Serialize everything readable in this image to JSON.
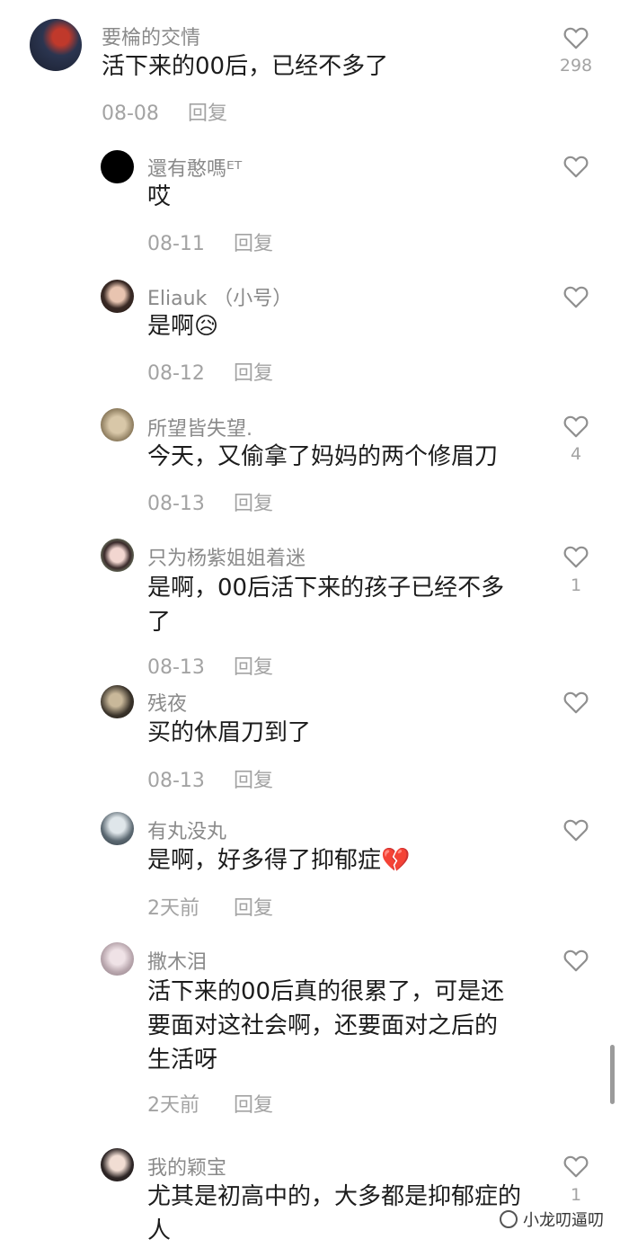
{
  "comments": [
    {
      "username": "要棆的交情",
      "text": "活下来的00后，已经不多了",
      "date": "08-08",
      "reply": "回复",
      "likes": "298"
    },
    {
      "username": "還有憨嗎ᴱᵀ",
      "text": "哎",
      "date": "08-11",
      "reply": "回复",
      "likes": ""
    },
    {
      "username": "Eliauk （小号）",
      "text": "是啊😥",
      "date": "08-12",
      "reply": "回复",
      "likes": ""
    },
    {
      "username": "所望皆失望.",
      "text": "今天，又偷拿了妈妈的两个修眉刀",
      "date": "08-13",
      "reply": "回复",
      "likes": "4"
    },
    {
      "username": "只为杨紫姐姐着迷",
      "text": "是啊，00后活下来的孩子已经不多了",
      "date": "08-13",
      "reply": "回复",
      "likes": "1"
    },
    {
      "username": "残夜",
      "text": "买的休眉刀到了",
      "date": "08-13",
      "reply": "回复",
      "likes": ""
    },
    {
      "username": "有丸没丸",
      "text": "是啊，好多得了抑郁症💔",
      "date": "2天前",
      "reply": "回复",
      "likes": ""
    },
    {
      "username": "撒木泪",
      "text": "活下来的00后真的很累了，可是还要面对这社会啊，还要面对之后的生活呀",
      "date": "2天前",
      "reply": "回复",
      "likes": ""
    },
    {
      "username": "我的颖宝",
      "text": "尤其是初高中的，大多都是抑郁症的人",
      "date": "",
      "reply": "",
      "likes": "1"
    }
  ],
  "watermark": "小龙叨逼叨",
  "icons": {
    "like": "heart-outline-icon",
    "watermark": "wechat-channel-icon"
  },
  "colors": {
    "username": "#8a8a8a",
    "text": "#1c1c1c",
    "meta": "#a3a3a3"
  }
}
